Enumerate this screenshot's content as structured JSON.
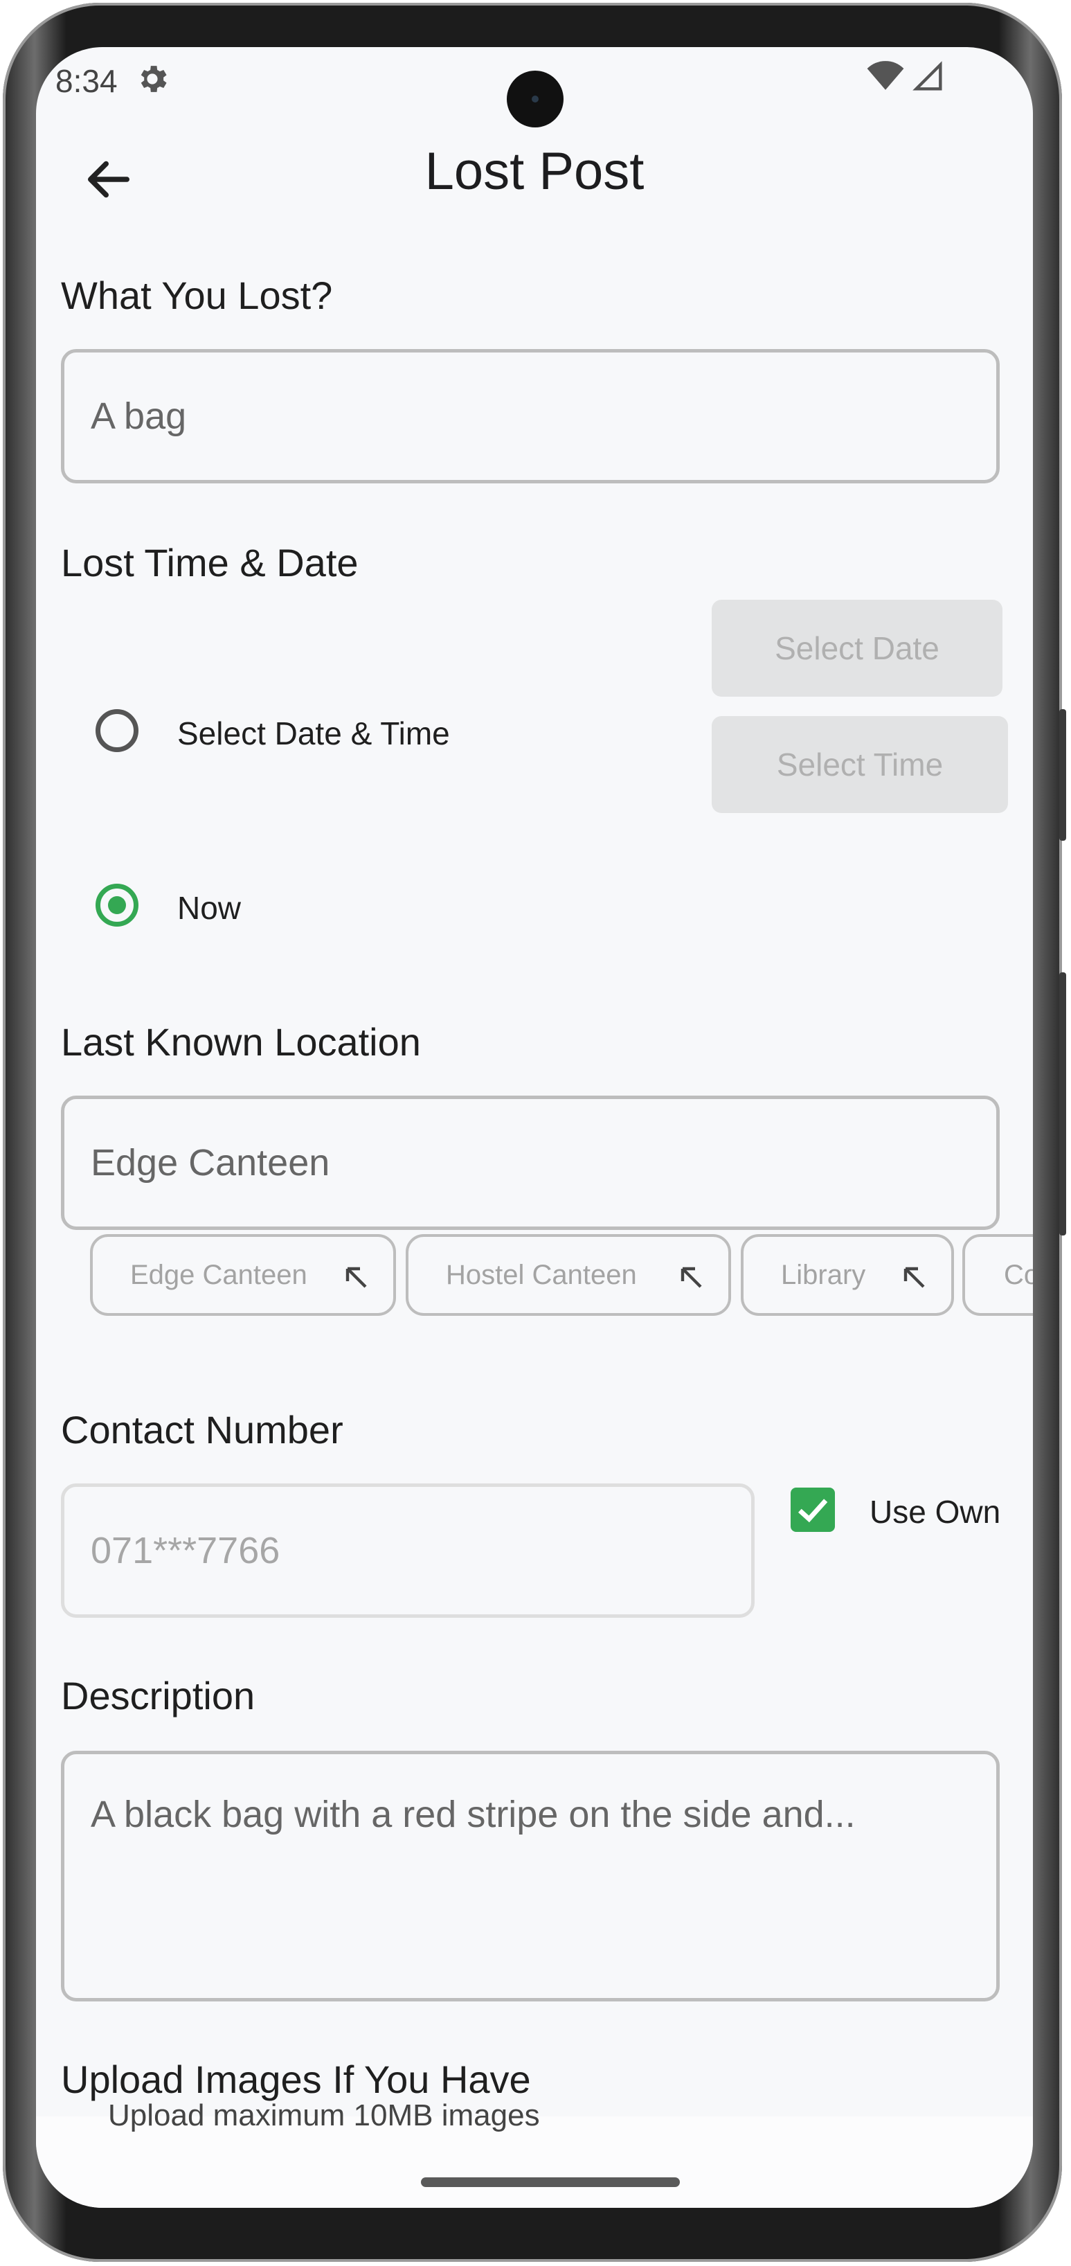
{
  "status_bar": {
    "time": "8:34"
  },
  "header": {
    "title": "Lost Post"
  },
  "what_lost": {
    "label": "What You Lost?",
    "value": "A bag"
  },
  "lost_time": {
    "label": "Lost Time & Date",
    "option_select": "Select Date & Time",
    "option_now": "Now",
    "selected": "Now",
    "select_date_button": "Select Date",
    "select_time_button": "Select Time"
  },
  "location": {
    "label": "Last Known Location",
    "value": "Edge Canteen",
    "suggestions": [
      "Edge Canteen",
      "Hostel Canteen",
      "Library",
      "Co"
    ]
  },
  "contact": {
    "label": "Contact Number",
    "placeholder": "071***7766",
    "use_own_label": "Use Own",
    "use_own_checked": true
  },
  "description": {
    "label": "Description",
    "value": "A black bag with a red stripe on the side and..."
  },
  "upload": {
    "label": "Upload Images If You Have",
    "hint": "Upload maximum 10MB images"
  },
  "colors": {
    "accent": "#34a853",
    "background": "#f7f8fa",
    "border": "#bdbdbd",
    "disabled_button": "#e2e3e4"
  }
}
